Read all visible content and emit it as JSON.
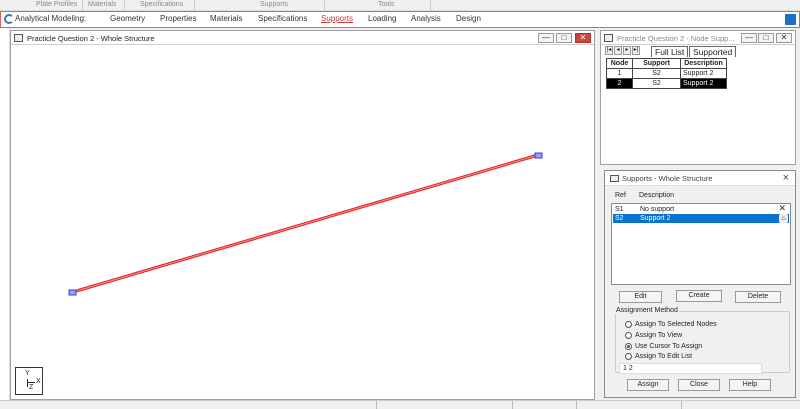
{
  "ribbon_groups": [
    "Plate Profiles",
    "Materials",
    "Specifications",
    "Tools"
  ],
  "nav": {
    "lead": "Analytical Modeling:",
    "tabs": [
      "Geometry",
      "Properties",
      "Materials",
      "Specifications",
      "Supports",
      "Loading",
      "Analysis",
      "Design"
    ],
    "active": "Supports"
  },
  "main_window": {
    "title": "Practicle Question 2 - Whole Structure",
    "buttons": [
      "—",
      "□",
      "✕"
    ],
    "axes": {
      "y": "Y",
      "x": "X",
      "z": "Z"
    }
  },
  "node_window": {
    "title": "Practicle Question 2 - Node Supp...",
    "tabs": [
      "Full List",
      "Supported"
    ],
    "columns": [
      "Node",
      "Support",
      "Description"
    ],
    "rows": [
      {
        "node": "1",
        "support": "S2",
        "description": "Support 2"
      },
      {
        "node": "2",
        "support": "S2",
        "description": "Support 2"
      }
    ]
  },
  "supports_dialog": {
    "title": "Supports - Whole Structure",
    "col_ref": "Ref",
    "col_desc": "Description",
    "items": [
      {
        "ref": "S1",
        "desc": "No support"
      },
      {
        "ref": "S2",
        "desc": "Support 2"
      }
    ],
    "edit": "Edit",
    "create": "Create",
    "delete": "Delete",
    "assignment_method": "Assignment Method",
    "options": [
      "Assign To Selected Nodes",
      "Assign To View",
      "Use Cursor To Assign",
      "Assign To Edit List"
    ],
    "selected_option": "Use Cursor To Assign",
    "edit_list_value": "1 2",
    "assign": "Assign",
    "close": "Close",
    "help": "Help"
  },
  "colors": {
    "member": "#e02020",
    "selection": "#0a73d1",
    "active_tab": "#c04040"
  }
}
